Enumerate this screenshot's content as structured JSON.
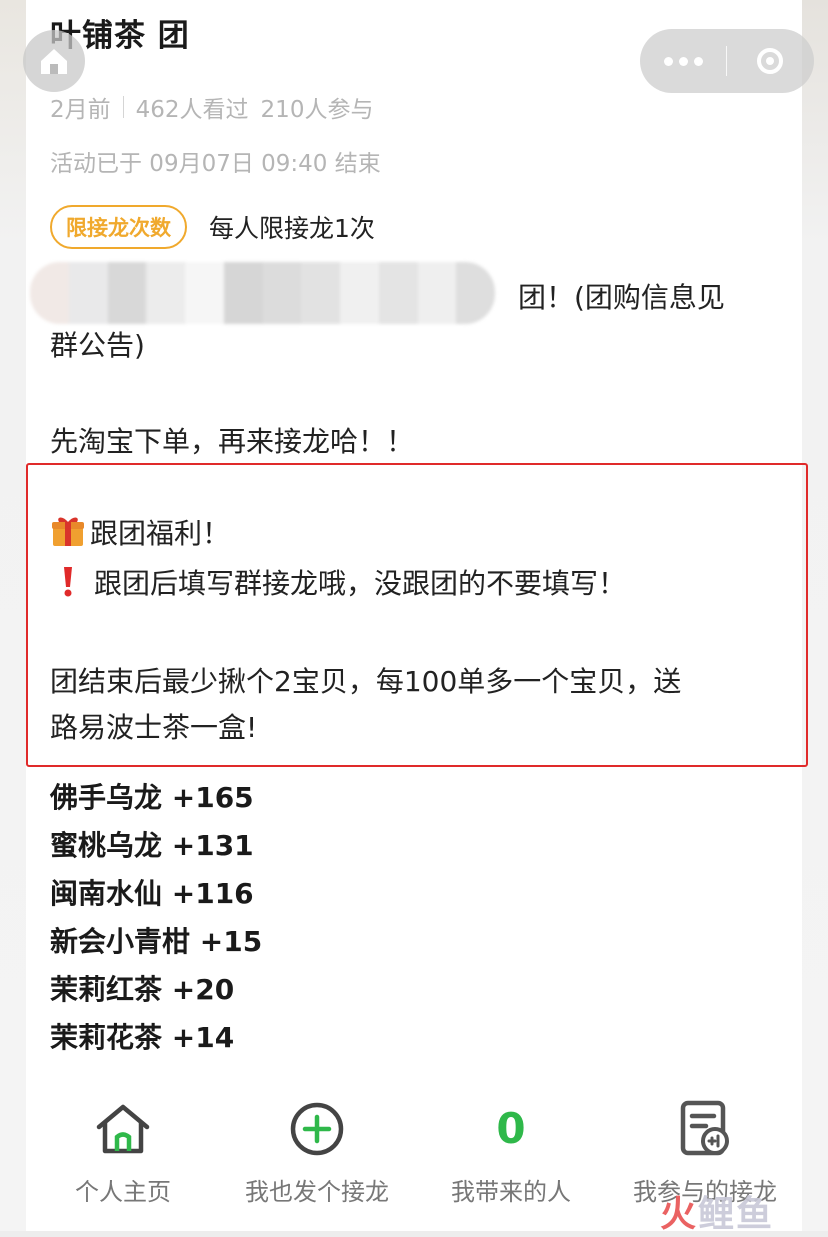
{
  "header": {
    "title": "叶铺茶 团"
  },
  "meta": {
    "time_ago": "2月前",
    "views": "462人看过",
    "participants": "210人参与",
    "activity_end": "活动已于 09月07日 09:40 结束"
  },
  "limit": {
    "badge": "限接龙次数",
    "text": "每人限接龙1次"
  },
  "description": {
    "line1_visible": "团！(团购信息见",
    "line2": "群公告)",
    "order_note": "先淘宝下单，再来接龙哈！！"
  },
  "benefits": {
    "heading": "跟团福利！",
    "warning": "跟团后填写群接龙哦，没跟团的不要填写！",
    "rule_line1": "团结束后最少揪个2宝贝，每100单多一个宝贝，送",
    "rule_line2": "路易波士茶一盒!"
  },
  "items": [
    {
      "label": "佛手乌龙 +165"
    },
    {
      "label": "蜜桃乌龙 +131"
    },
    {
      "label": "闽南水仙 +116"
    },
    {
      "label": "新会小青柑 +15"
    },
    {
      "label": "茉莉红茶 +20"
    },
    {
      "label": "茉莉花茶 +14"
    }
  ],
  "bottom_nav": [
    {
      "label": "个人主页",
      "icon": "home-icon"
    },
    {
      "label": "我也发个接龙",
      "icon": "plus-circle-icon"
    },
    {
      "label": "我带来的人",
      "count": "0"
    },
    {
      "label": "我参与的接龙",
      "icon": "document-plus-icon"
    }
  ],
  "watermark": [
    "火",
    "鲤",
    "鱼"
  ],
  "colors": {
    "accent_orange": "#f0a92d",
    "red_border": "#e02a2a",
    "green": "#2fb84a",
    "gray_text": "#b5b5b5"
  }
}
